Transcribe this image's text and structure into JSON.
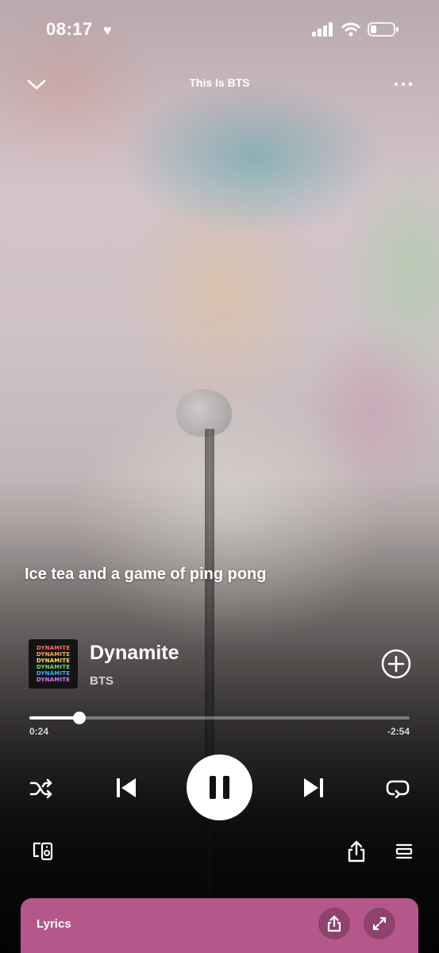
{
  "status_bar": {
    "time": "08:17",
    "heart": "♥"
  },
  "header": {
    "title": "This Is BTS",
    "collapse_icon": "chevron-down-icon",
    "more_icon": "more-horizontal-icon"
  },
  "video": {
    "lyric_line": "Ice tea and a game of ping pong"
  },
  "track": {
    "title": "Dynamite",
    "artist": "BTS",
    "album_art_text": [
      "DYNAMITE",
      "DYNAMITE",
      "DYNAMITE",
      "DYNAMITE",
      "DYNAMITE",
      "DYNAMITE"
    ],
    "album_art_colors": [
      "#ff6b6b",
      "#ffa94d",
      "#ffe066",
      "#69db7c",
      "#4dabf7",
      "#da77f2"
    ]
  },
  "progress": {
    "elapsed": "0:24",
    "remaining": "-2:54",
    "fraction": 0.131
  },
  "controls": {
    "shuffle": "shuffle-icon",
    "previous": "skip-back-icon",
    "play_pause": "pause-icon",
    "next": "skip-forward-icon",
    "repeat": "repeat-icon",
    "devices": "connect-device-icon",
    "share": "share-icon",
    "queue": "queue-icon"
  },
  "lyrics_card": {
    "label": "Lyrics",
    "background": "#b5578a"
  },
  "colors": {
    "accent": "#ffffff",
    "lyrics_card": "#b5578a"
  }
}
